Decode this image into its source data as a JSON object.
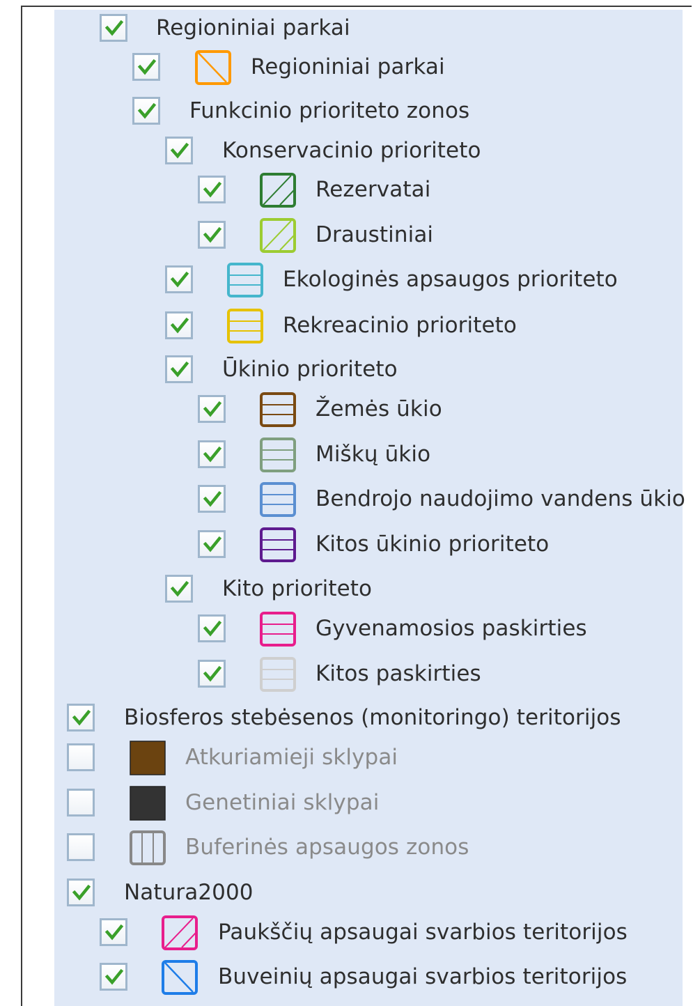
{
  "colors": {
    "checkmark": "#3aa02a",
    "checkbox_border": "#9fb6cc",
    "panel_bg": "#dfe8f6",
    "regional_park": "#ff9900",
    "reserves": "#2e7d32",
    "sanctuaries": "#9ccc32",
    "ecological": "#45b6cc",
    "recreation": "#e6c200",
    "agriculture": "#7a4a12",
    "forestry": "#7f9f7f",
    "water": "#5b8fd1",
    "other_economic": "#5e1b8f",
    "residential": "#e81e8c",
    "other_purpose": "#cfcfcf",
    "restoration_plots": "#6b4310",
    "genetic_plots": "#333333",
    "buffer_zones": "#888888",
    "birds": "#e81e8c",
    "habitats": "#1e7de8"
  },
  "layers": [
    {
      "label": "Regioniniai parkai",
      "checked": true,
      "group": true,
      "icon": "none"
    },
    {
      "label": "Regioniniai parkai",
      "checked": true,
      "group": false,
      "icon": "hatch-backslash-orange"
    },
    {
      "label": "Funkcinio prioriteto zonos",
      "checked": true,
      "group": true,
      "icon": "none"
    },
    {
      "label": "Konservacinio prioriteto",
      "checked": true,
      "group": true,
      "icon": "none"
    },
    {
      "label": "Rezervatai",
      "checked": true,
      "group": false,
      "icon": "hatch-slash-darkgreen"
    },
    {
      "label": "Draustiniai",
      "checked": true,
      "group": false,
      "icon": "hatch-slash-lightgreen"
    },
    {
      "label": "Ekologinės apsaugos prioriteto",
      "checked": true,
      "group": false,
      "icon": "horizontal-lines-cyan"
    },
    {
      "label": "Rekreacinio prioriteto",
      "checked": true,
      "group": false,
      "icon": "horizontal-lines-yellow"
    },
    {
      "label": "Ūkinio prioriteto",
      "checked": true,
      "group": true,
      "icon": "none"
    },
    {
      "label": "Žemės ūkio",
      "checked": true,
      "group": false,
      "icon": "horizontal-lines-brown"
    },
    {
      "label": "Miškų ūkio",
      "checked": true,
      "group": false,
      "icon": "horizontal-lines-grey-green"
    },
    {
      "label": "Bendrojo naudojimo vandens ūkio",
      "checked": true,
      "group": false,
      "icon": "horizontal-lines-blue"
    },
    {
      "label": "Kitos ūkinio prioriteto",
      "checked": true,
      "group": false,
      "icon": "horizontal-lines-purple"
    },
    {
      "label": "Kito prioriteto",
      "checked": true,
      "group": true,
      "icon": "none"
    },
    {
      "label": "Gyvenamosios paskirties",
      "checked": true,
      "group": false,
      "icon": "horizontal-lines-magenta"
    },
    {
      "label": "Kitos paskirties",
      "checked": true,
      "group": false,
      "icon": "horizontal-lines-lightgrey"
    },
    {
      "label": "Biosferos stebėsenos (monitoringo) teritorijos",
      "checked": true,
      "group": true,
      "icon": "none"
    },
    {
      "label": "Atkuriamieji sklypai",
      "checked": false,
      "group": false,
      "icon": "solid-brown"
    },
    {
      "label": "Genetiniai sklypai",
      "checked": false,
      "group": false,
      "icon": "solid-darkgrey"
    },
    {
      "label": "Buferinės apsaugos zonos",
      "checked": false,
      "group": false,
      "icon": "vertical-lines-grey"
    },
    {
      "label": "Natura2000",
      "checked": true,
      "group": true,
      "icon": "none"
    },
    {
      "label": "Paukščių apsaugai svarbios teritorijos",
      "checked": true,
      "group": false,
      "icon": "hatch-slash-magenta"
    },
    {
      "label": "Buveinių apsaugai svarbios teritorijos",
      "checked": true,
      "group": false,
      "icon": "hatch-backslash-blue"
    }
  ]
}
